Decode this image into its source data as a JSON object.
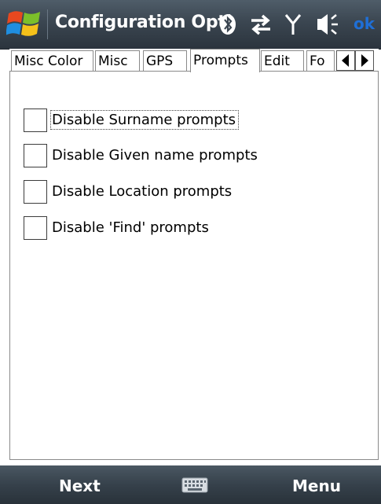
{
  "titlebar": {
    "title": "Configuration Opti",
    "ok_label": "ok",
    "icons": [
      "windows-start-icon",
      "bluetooth-icon",
      "sync-arrows-icon",
      "signal-antenna-icon",
      "speaker-volume-icon"
    ]
  },
  "tabs": [
    {
      "label": "Misc Color"
    },
    {
      "label": "Misc"
    },
    {
      "label": "GPS"
    },
    {
      "label": "Prompts",
      "active": true
    },
    {
      "label": "Edit"
    },
    {
      "label": "Fo"
    }
  ],
  "options": [
    {
      "label": "Disable Surname prompts",
      "checked": false,
      "focused": true
    },
    {
      "label": "Disable Given name prompts",
      "checked": false
    },
    {
      "label": "Disable Location prompts",
      "checked": false
    },
    {
      "label": "Disable 'Find' prompts",
      "checked": false
    }
  ],
  "softkeys": {
    "left": "Next",
    "right": "Menu"
  },
  "colors": {
    "titlebar": "#3b4651",
    "ok": "#1f6fd6",
    "softbar": "#36414b"
  }
}
